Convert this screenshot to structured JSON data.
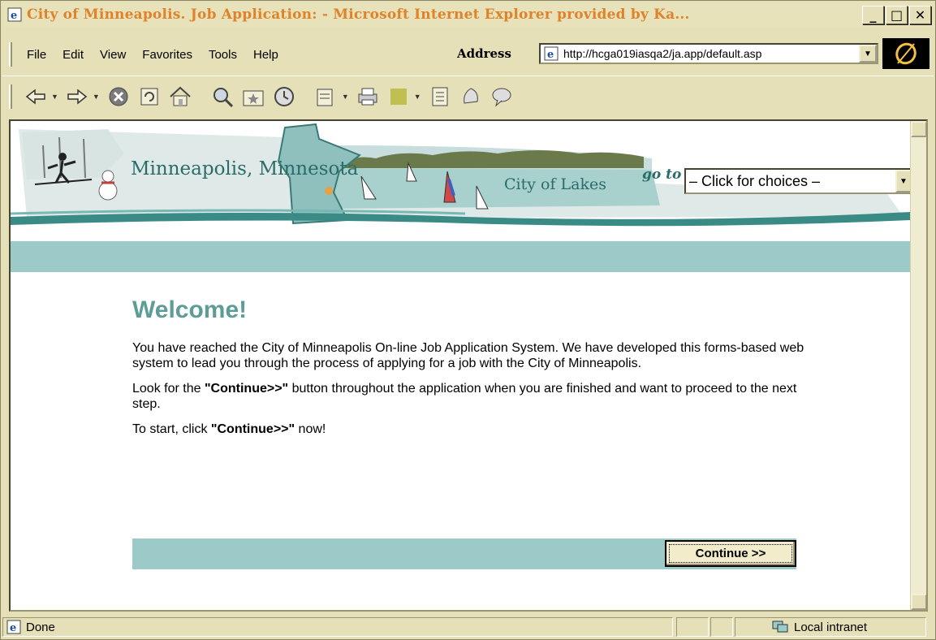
{
  "window": {
    "title": "City of Minneapolis. Job Application: - Microsoft Internet Explorer provided by Ka...",
    "controls": {
      "minimize": "_",
      "maximize": "□",
      "close": "✕"
    }
  },
  "menu": [
    "File",
    "Edit",
    "View",
    "Favorites",
    "Tools",
    "Help"
  ],
  "address": {
    "label": "Address",
    "url": "http://hcga019iasqa2/ja.app/default.asp"
  },
  "toolbar": {
    "icons": [
      "back-icon",
      "forward-icon",
      "stop-icon",
      "refresh-icon",
      "home-icon",
      "search-icon",
      "favorites-icon",
      "history-icon",
      "mail-icon",
      "print-icon",
      "edit-icon",
      "discuss-icon",
      "messenger-icon"
    ]
  },
  "banner": {
    "city_text": "Minneapolis, Minnesota",
    "tagline": "City of Lakes",
    "goto_label": "go to",
    "goto_select": "– Click for choices –"
  },
  "page": {
    "welcome": "Welcome!",
    "para1": "You have reached the City of Minneapolis On-line Job Application System. We have developed this forms-based web system to lead you through the process of applying for a job with the City of Minneapolis.",
    "para2_pre": "Look for the ",
    "para2_bold": "\"Continue>>\"",
    "para2_post": " button throughout the application when you are finished and want to proceed to the next step.",
    "para3_pre": "To start, click ",
    "para3_bold": "\"Continue>>\"",
    "para3_post": " now!",
    "continue_button": "Continue >>"
  },
  "status": {
    "text": "Done",
    "zone": "Local intranet"
  },
  "colors": {
    "title_text": "#e0822a",
    "teal_bar": "#9ccac8",
    "welcome": "#5e9c98",
    "chrome": "#e6e0b8"
  }
}
